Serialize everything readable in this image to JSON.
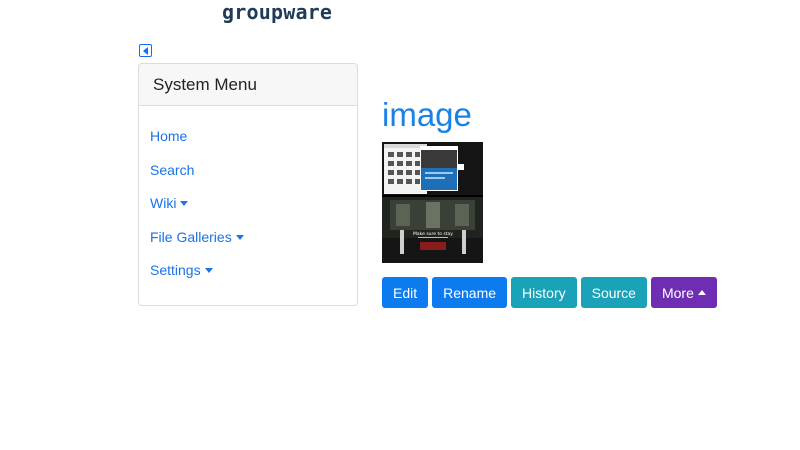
{
  "header": {
    "logo_text": "groupware"
  },
  "sidebar": {
    "title": "System Menu",
    "items": [
      {
        "label": "Home",
        "has_dropdown": false
      },
      {
        "label": "Search",
        "has_dropdown": false
      },
      {
        "label": "Wiki",
        "has_dropdown": true
      },
      {
        "label": "File Galleries",
        "has_dropdown": true
      },
      {
        "label": "Settings",
        "has_dropdown": true
      }
    ]
  },
  "main": {
    "title": "image",
    "thumbnail": {
      "overlay_text": "Make sure to stay"
    },
    "actions": {
      "edit": "Edit",
      "rename": "Rename",
      "history": "History",
      "source": "Source",
      "more": "More"
    }
  },
  "colors": {
    "link": "#1a73e8",
    "primary": "#0d7bf0",
    "info": "#19a2b8",
    "purple": "#6f2db3"
  }
}
